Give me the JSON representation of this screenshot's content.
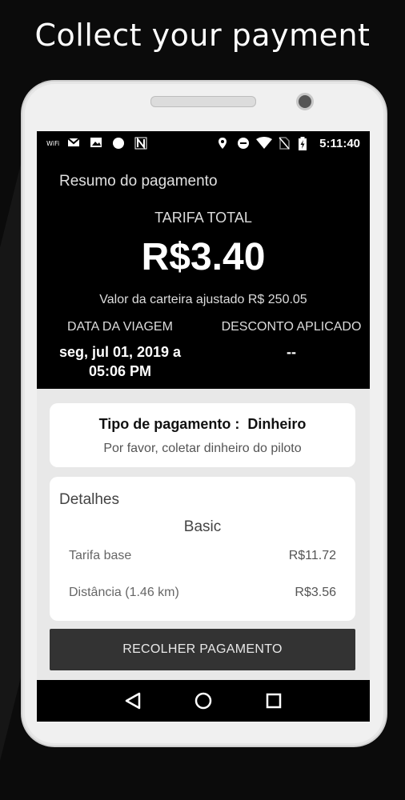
{
  "headline": "Collect your payment",
  "statusbar": {
    "time": "5:11:40",
    "icons_left": [
      "wifi-call-icon",
      "gmail-icon",
      "image-icon",
      "circle-icon",
      "n-app-icon"
    ],
    "icons_right": [
      "location-icon",
      "do-not-disturb-icon",
      "wifi-icon",
      "no-sim-icon",
      "battery-icon"
    ]
  },
  "summary": {
    "title": "Resumo do pagamento",
    "fare_label": "TARIFA TOTAL",
    "fare_amount": "R$3.40",
    "wallet_text": "Valor da carteira ajustado R$ 250.05",
    "trip_date_label": "DATA DA VIAGEM",
    "trip_date_value_line1": "seg, jul 01, 2019 a",
    "trip_date_value_line2": "05:06 PM",
    "discount_label": "DESCONTO APLICADO",
    "discount_value": "--"
  },
  "payment": {
    "type_label": "Tipo de pagamento :",
    "type_value": "Dinheiro",
    "instruction": "Por favor, coletar dinheiro do piloto"
  },
  "details": {
    "title": "Detalhes",
    "category": "Basic",
    "rows": [
      {
        "label": "Tarifa base",
        "value": "R$11.72"
      },
      {
        "label": "Distância (1.46 km)",
        "value": "R$3.56"
      }
    ]
  },
  "collect_button": "RECOLHER PAGAMENTO",
  "navbar": {
    "buttons": [
      "back-icon",
      "home-icon",
      "recents-icon"
    ]
  },
  "colors": {
    "screen_bg": "#000000",
    "card_bg": "#ffffff",
    "button_bg": "#333333"
  }
}
